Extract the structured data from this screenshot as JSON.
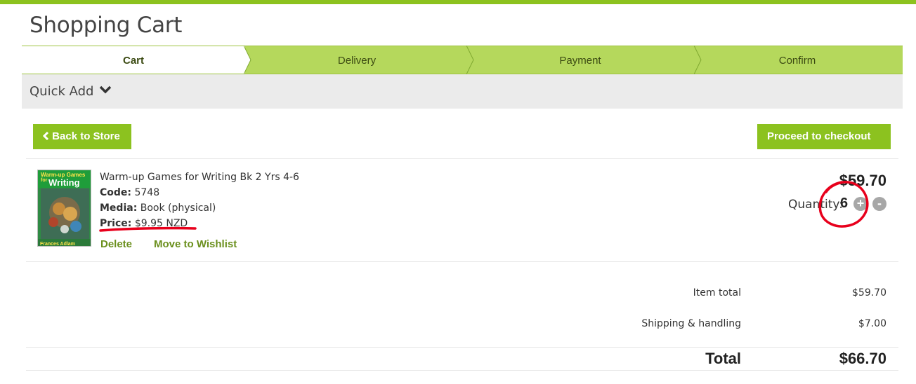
{
  "page": {
    "title": "Shopping Cart"
  },
  "steps": [
    {
      "label": "Cart",
      "active": true
    },
    {
      "label": "Delivery",
      "active": false
    },
    {
      "label": "Payment",
      "active": false
    },
    {
      "label": "Confirm",
      "active": false
    }
  ],
  "quick_add": {
    "label": "Quick Add",
    "icon": "chevron-down-icon"
  },
  "buttons": {
    "back_label": "Back to Store",
    "back_icon": "chevron-left-icon",
    "checkout_label": "Proceed to checkout",
    "checkout_icon": "chevron-right-icon"
  },
  "product": {
    "name": "Warm-up Games for Writing Bk 2 Yrs 4-6",
    "code_label": "Code:",
    "code": "5748",
    "media_label": "Media:",
    "media": "Book (physical)",
    "price_label": "Price:",
    "price": "$9.95 NZD",
    "delete_label": "Delete",
    "wishlist_label": "Move to Wishlist",
    "line_price": "$59.70",
    "qty_label": "Quantity:",
    "qty": "6",
    "plus": "+",
    "minus": "-",
    "cover": {
      "title_line1": "Warm-up Games",
      "title_line2": "for",
      "title_line3": "Writing",
      "author": "Frances Adlam"
    }
  },
  "totals": {
    "item_total_label": "Item total",
    "item_total": "$59.70",
    "shipping_label": "Shipping & handling",
    "shipping": "$7.00",
    "total_label": "Total",
    "total": "$66.70"
  },
  "colors": {
    "accent": "#8cc21f",
    "step_bg": "#b5d85c",
    "link": "#6a8f1c",
    "annotation": "#e8001c"
  }
}
